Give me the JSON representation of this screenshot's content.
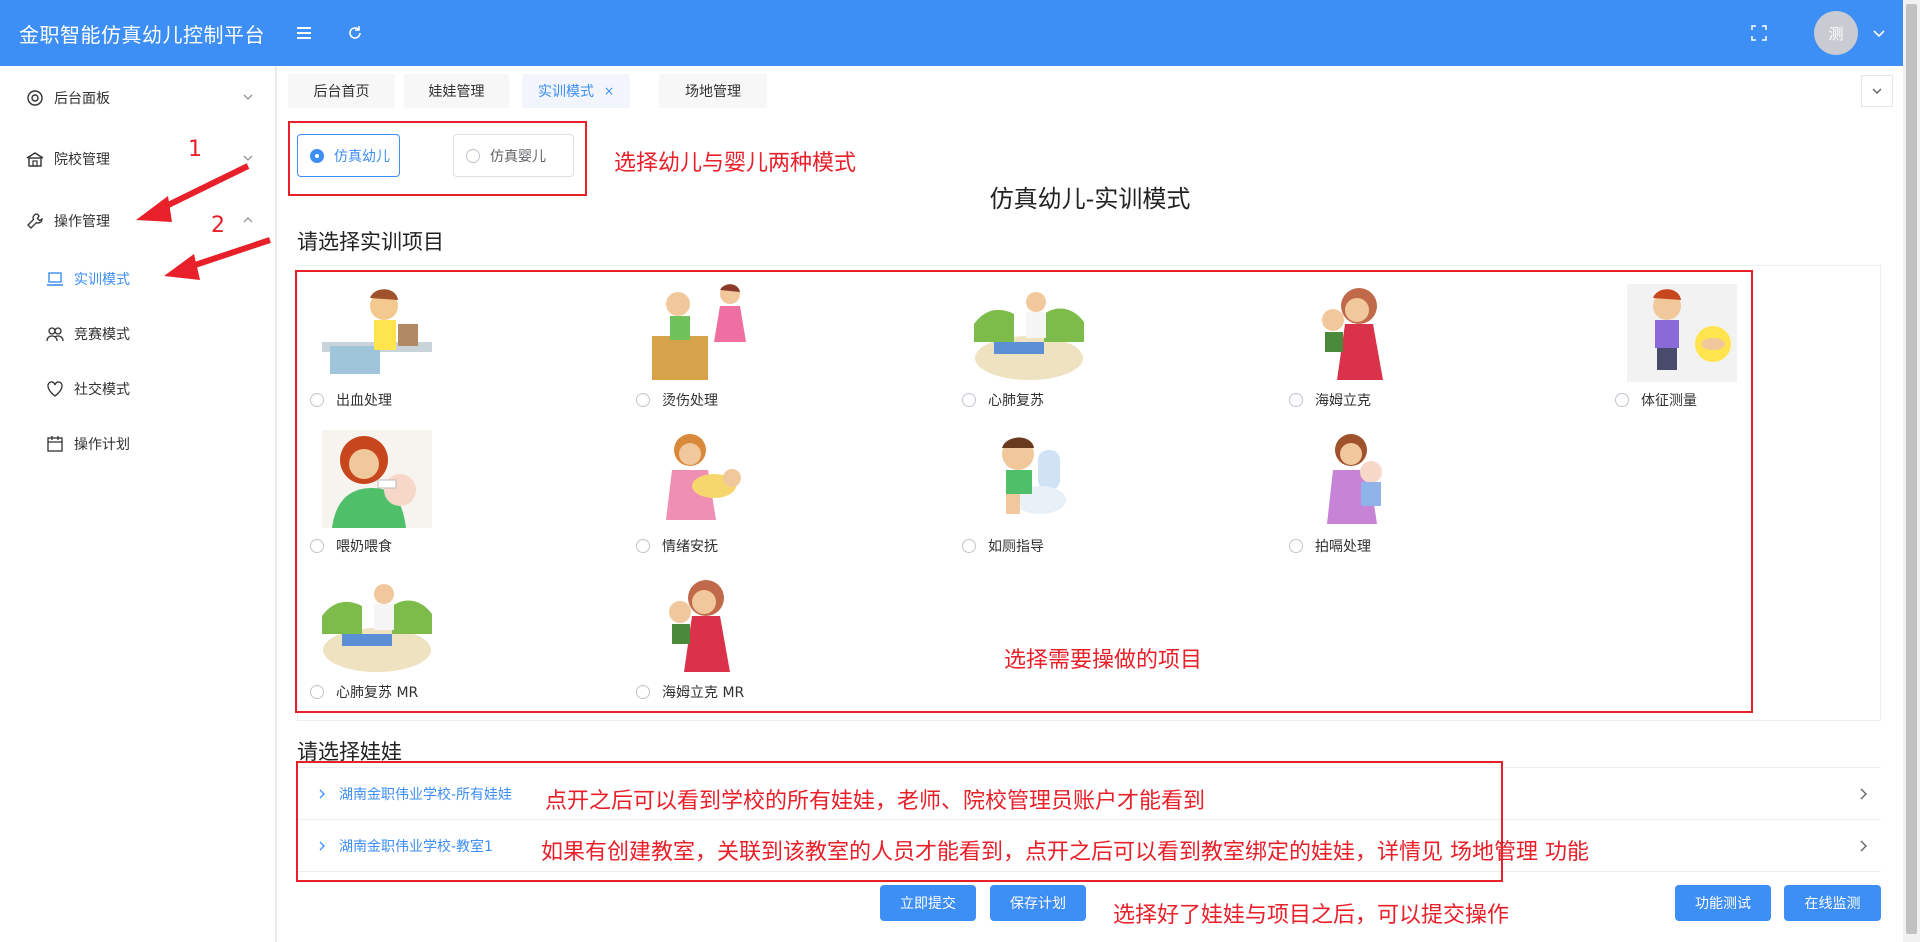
{
  "header": {
    "title": "金职智能仿真幼儿控制平台",
    "avatar_text": "测"
  },
  "sidebar": {
    "items": [
      {
        "label": "后台面板"
      },
      {
        "label": "院校管理"
      },
      {
        "label": "操作管理"
      }
    ],
    "sub_items": [
      {
        "label": "实训模式"
      },
      {
        "label": "竞赛模式"
      },
      {
        "label": "社交模式"
      },
      {
        "label": "操作计划"
      }
    ]
  },
  "tabs": [
    {
      "label": "后台首页"
    },
    {
      "label": "娃娃管理"
    },
    {
      "label": "实训模式",
      "close": "×"
    },
    {
      "label": "场地管理"
    }
  ],
  "mode": {
    "options": [
      {
        "label": "仿真幼儿"
      },
      {
        "label": "仿真婴儿"
      }
    ],
    "selected": "仿真幼儿",
    "title": "仿真幼儿-实训模式"
  },
  "projects": {
    "section_title": "请选择实训项目",
    "items": [
      {
        "label": "出血处理"
      },
      {
        "label": "烫伤处理"
      },
      {
        "label": "心肺复苏"
      },
      {
        "label": "海姆立克"
      },
      {
        "label": "体征测量"
      },
      {
        "label": "喂奶喂食"
      },
      {
        "label": "情绪安抚"
      },
      {
        "label": "如厕指导"
      },
      {
        "label": "拍嗝处理"
      },
      {
        "label": "心肺复苏 MR"
      },
      {
        "label": "海姆立克 MR"
      }
    ]
  },
  "dolls": {
    "section_title": "请选择娃娃",
    "groups": [
      {
        "label": "湖南金职伟业学校-所有娃娃"
      },
      {
        "label": "湖南金职伟业学校-教室1"
      }
    ]
  },
  "buttons": {
    "submit": "立即提交",
    "save_plan": "保存计划",
    "func_test": "功能测试",
    "online_monitor": "在线监测"
  },
  "annotations": {
    "step1": "1",
    "step2": "2",
    "mode_note": "选择幼儿与婴儿两种模式",
    "project_note": "选择需要操做的项目",
    "doll_note1": "点开之后可以看到学校的所有娃娃，老师、院校管理员账户才能看到",
    "doll_note2": "如果有创建教室，关联到该教室的人员才能看到，点开之后可以看到教室绑定的娃娃，详情见 场地管理 功能",
    "submit_note": "选择好了娃娃与项目之后，可以提交操作"
  },
  "colors": {
    "primary": "#3d8ef5",
    "annotation": "#e8202a"
  }
}
